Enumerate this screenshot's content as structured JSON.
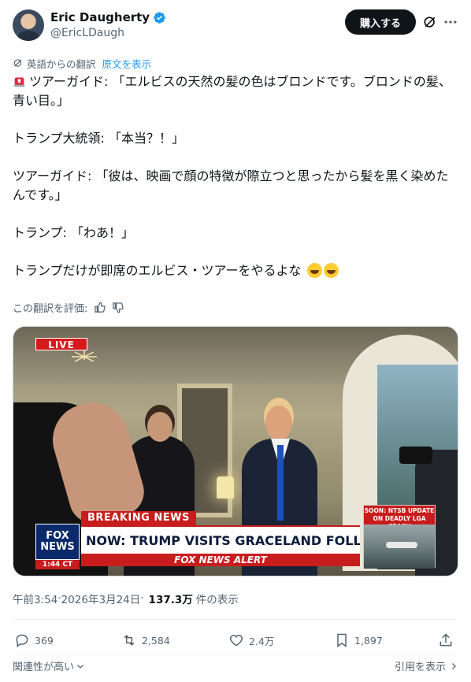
{
  "author": {
    "display_name": "Eric Daugherty",
    "handle": "@EricLDaugh",
    "buy_button": "購入する"
  },
  "translation": {
    "note": "英語からの翻訳",
    "show_original": "原文を表示"
  },
  "tweet": {
    "lines": [
      "ツアーガイド: 「エルビスの天然の髪の色はブロンドです。ブロンドの髪、青い目。」",
      "トランプ大統領: 「本当？！」",
      "ツアーガイド: 「彼は、映画で顔の特徴が際立つと思ったから髪を黒く染めたんです。」",
      "トランプ: 「わあ！」",
      "トランプだけが即席のエルビス・ツアーをやるよな"
    ]
  },
  "rate_label": "この翻訳を評価:",
  "media": {
    "live": "LIVE",
    "breaking": "BREAKING NEWS",
    "headline": "NOW: TRUMP VISITS GRACELAND FOLLOWING ROUNDTABLE",
    "alert": "FOX NEWS ALERT",
    "logo_line1": "FOX",
    "logo_line2": "NEWS",
    "time": "1:44 CT",
    "side_title": "SOON: NTSB UPDATE ON DEADLY LGA CRASH"
  },
  "meta": {
    "time": "午前3:54",
    "sep": " · ",
    "date": "2026年3月24日",
    "sep2": " · ",
    "views": "137.3万",
    "views_label": "件の表示"
  },
  "stats": {
    "replies": "369",
    "reposts": "2,584",
    "likes": "2.4万",
    "bookmarks": "1,897"
  },
  "footer": {
    "sort": "関連性が高い",
    "quotes": "引用を表示"
  },
  "colors": {
    "accent": "#1d9bf0",
    "text": "#0f1419",
    "muted": "#536471",
    "fox_red": "#c81d1d"
  }
}
